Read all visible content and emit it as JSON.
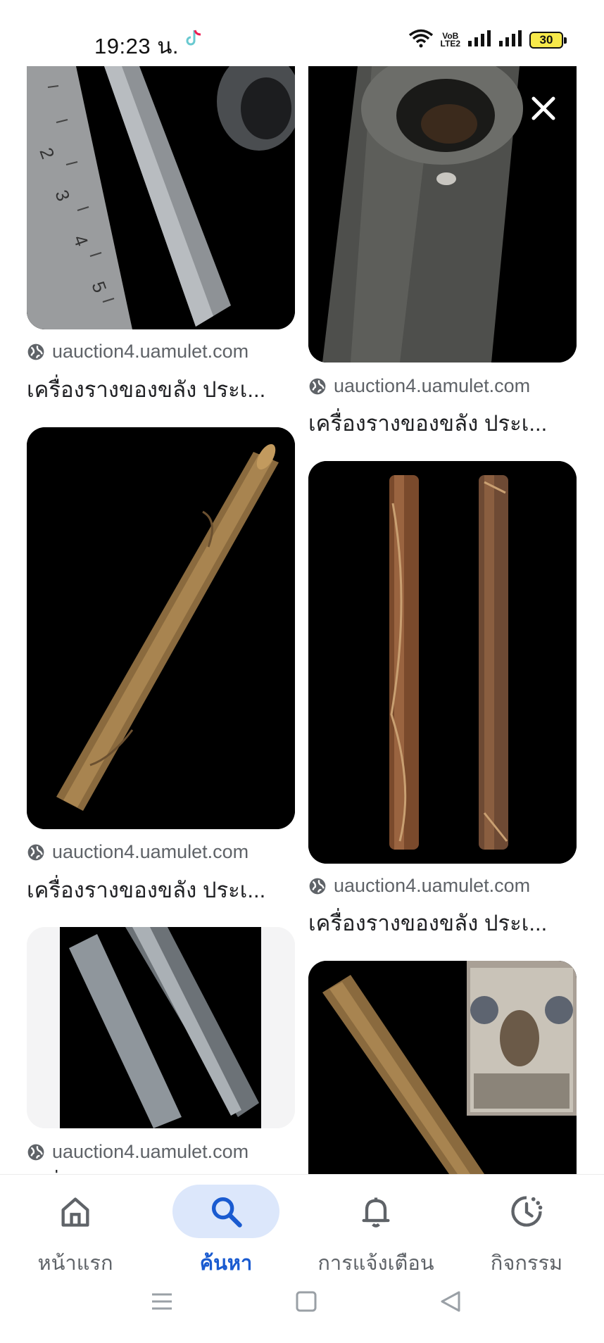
{
  "status_bar": {
    "time": "19:23 น.",
    "battery": "30",
    "volte_top": "VoB",
    "volte_bottom": "LTE2"
  },
  "results": {
    "left": [
      {
        "source": "uauction4.uamulet.com",
        "title": "เครื่องรางของขลัง ประเ..."
      },
      {
        "source": "uauction4.uamulet.com",
        "title": "เครื่องรางของขลัง ประเ..."
      },
      {
        "source": "uauction4.uamulet.com",
        "title": "เครื่องรางของขลัง ประเ..."
      }
    ],
    "right": [
      {
        "source": "uauction4.uamulet.com",
        "title": "เครื่องรางของขลัง ประเ..."
      },
      {
        "source": "uauction4.uamulet.com",
        "title": "เครื่องรางของขลัง ประเ..."
      }
    ]
  },
  "bottom_nav": {
    "items": [
      {
        "label": "หน้าแรก",
        "icon": "home-icon",
        "active": false
      },
      {
        "label": "ค้นหา",
        "icon": "search-icon",
        "active": true
      },
      {
        "label": "การแจ้งเตือน",
        "icon": "bell-icon",
        "active": false
      },
      {
        "label": "กิจกรรม",
        "icon": "activity-icon",
        "active": false
      }
    ]
  },
  "colors": {
    "accent": "#1a5bd0",
    "accent_bg": "#dce7fb",
    "meta_text": "#5f6368"
  }
}
